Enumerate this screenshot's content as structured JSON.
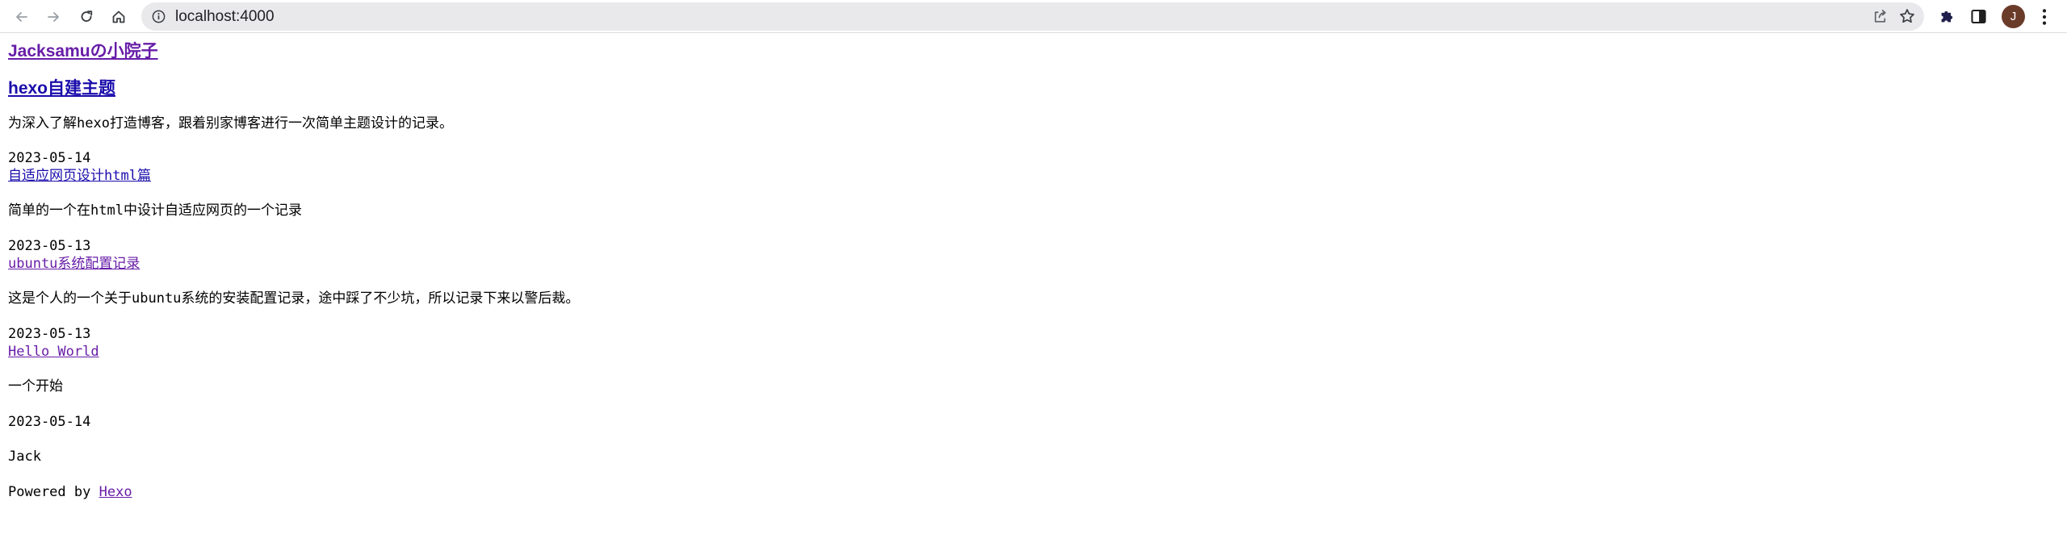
{
  "browser": {
    "url": "localhost:4000",
    "avatar_initial": "J",
    "icons": {
      "back": "arrow-left-icon",
      "forward": "arrow-right-icon",
      "reload": "reload-icon",
      "home": "home-icon",
      "info": "info-circle-icon",
      "share": "share-icon",
      "bookmark": "star-icon",
      "extensions": "puzzle-icon",
      "side_panel": "side-panel-icon",
      "menu": "kebab-menu-icon"
    },
    "colors": {
      "omnibox_bg": "#e9e9ec",
      "avatar_bg": "#6b3b2a"
    }
  },
  "page": {
    "site_title": "Jacksamuの小院子",
    "featured_post": {
      "title": "hexo自建主题",
      "excerpt": "为深入了解hexo打造博客，跟着别家博客进行一次简单主题设计的记录。",
      "date": "2023-05-14"
    },
    "posts": [
      {
        "title": "自适应网页设计html篇",
        "excerpt": "简单的一个在html中设计自适应网页的一个记录",
        "date": "2023-05-14"
      },
      {
        "title": "ubuntu系统配置记录",
        "excerpt": "这是个人的一个关于ubuntu系统的安装配置记录，途中踩了不少坑，所以记录下来以警后裁。",
        "date": "2023-05-13"
      },
      {
        "title": "Hello World",
        "excerpt": "一个开始",
        "date": "2023-05-13"
      }
    ],
    "footer": {
      "author": "Jack",
      "powered_by_prefix": "Powered by",
      "powered_by_link": "Hexo"
    },
    "colors": {
      "link": "#1a0dab",
      "visited_link": "#681da8"
    }
  }
}
